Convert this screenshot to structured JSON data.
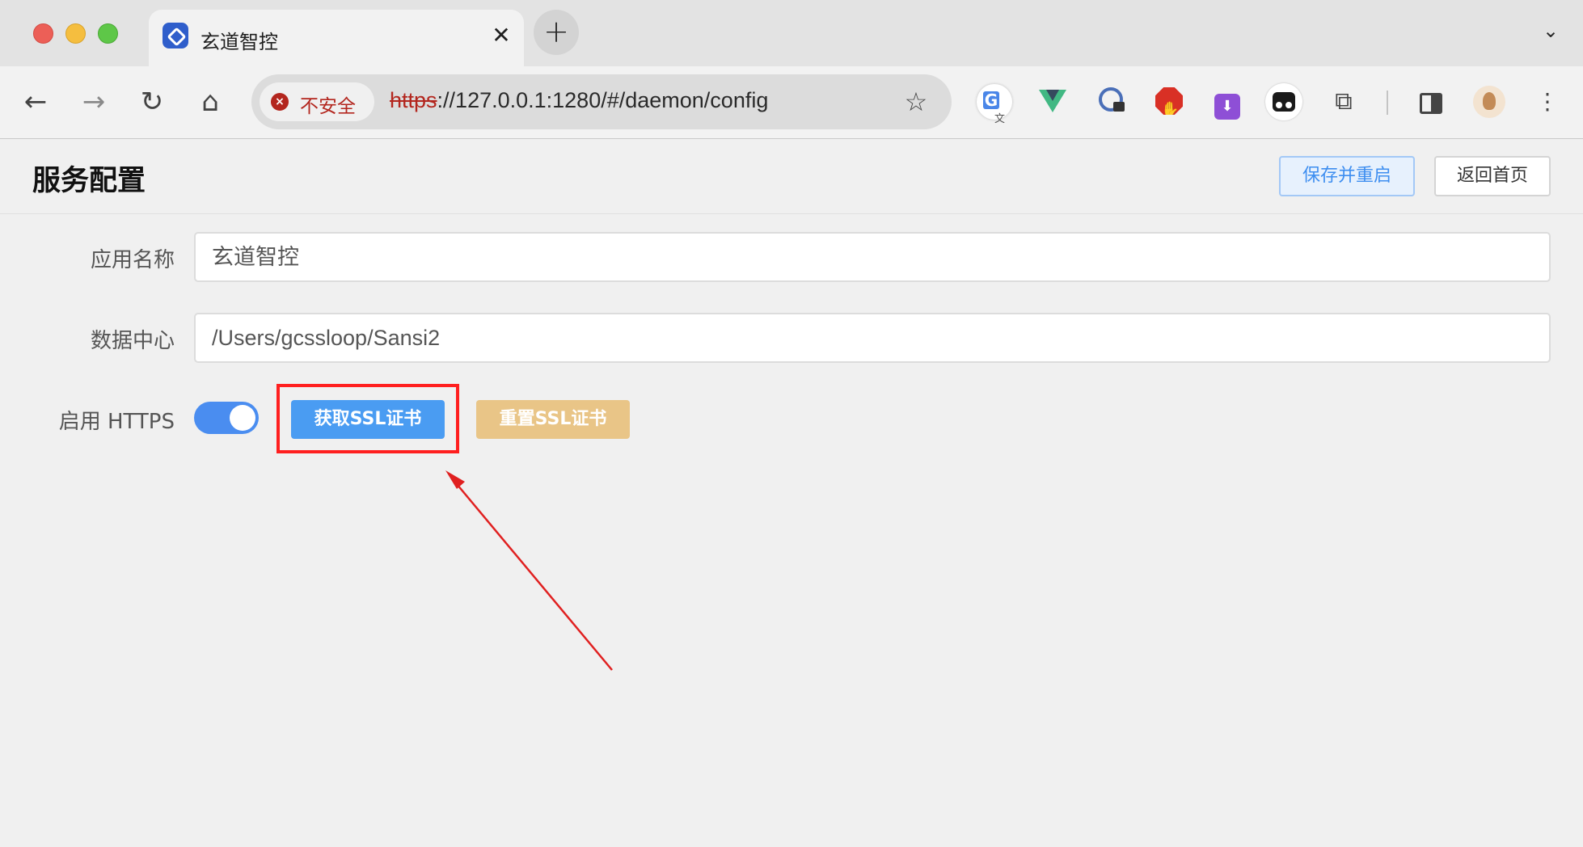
{
  "window": {
    "traffic_lights": [
      "close",
      "minimize",
      "maximize"
    ]
  },
  "tab": {
    "title": "玄道智控",
    "close_glyph": "✕",
    "favicon": "app-logo-icon"
  },
  "new_tab_glyph": "+",
  "tab_dropdown_glyph": "⌄",
  "toolbar": {
    "back_glyph": "←",
    "forward_glyph": "→",
    "reload_glyph": "↻",
    "home_glyph": "⌂",
    "security_label": "不安全",
    "url_scheme": "https",
    "url_rest": "://127.0.0.1:1280/#/daemon/config",
    "bookmark_glyph": "☆",
    "extensions": [
      "translate-icon",
      "vue-devtools-icon",
      "password-icon",
      "adblock-icon",
      "download-icon",
      "tampermonkey-icon",
      "puzzle-icon",
      "side-panel-icon",
      "profile-avatar-icon",
      "menu-icon"
    ],
    "puzzle_glyph": "⧉",
    "menu_glyph": "⋮",
    "download_glyph": "⬇"
  },
  "page": {
    "title": "服务配置",
    "save_button": "保存并重启",
    "home_button": "返回首页",
    "fields": {
      "app_name_label": "应用名称",
      "app_name_value": "玄道智控",
      "data_center_label": "数据中心",
      "data_center_value": "/Users/gcssloop/Sansi2",
      "https_label": "启用 HTTPS",
      "https_enabled": true
    },
    "get_ssl_button": "获取SSL证书",
    "reset_ssl_button": "重置SSL证书"
  },
  "colors": {
    "accent": "#4a9cf2",
    "warning": "#e9c587",
    "annotation": "#ff1f1f",
    "insecure": "#b3261e"
  }
}
